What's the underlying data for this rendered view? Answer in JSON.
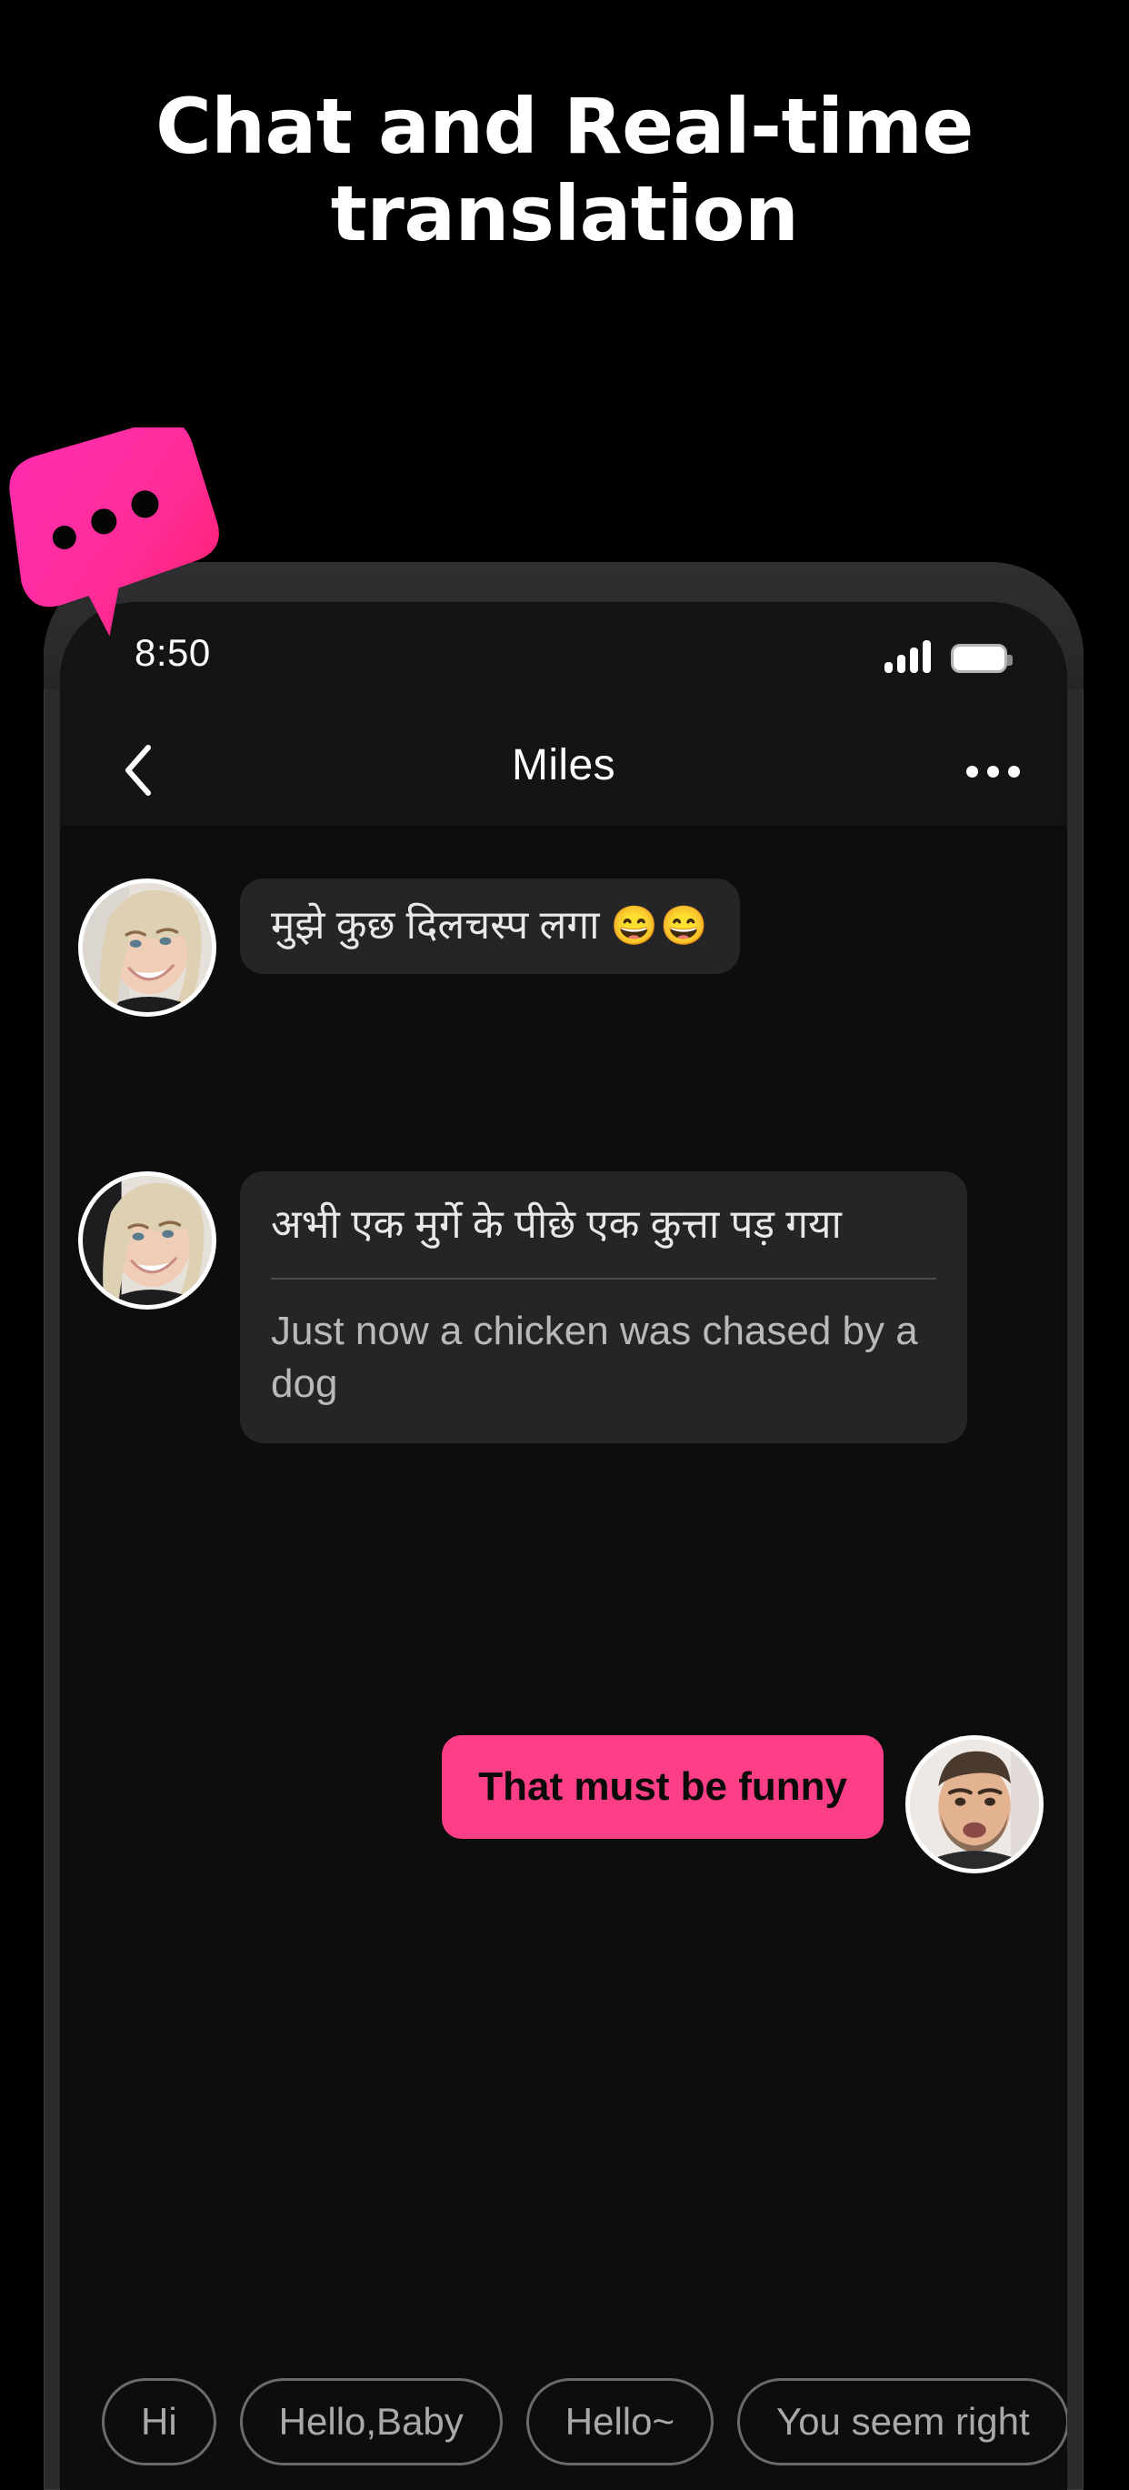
{
  "promo": {
    "headline": "Chat and Real-time\ntranslation",
    "badge_icon": "chat-bubble-icon",
    "accent_color": "#fb3e86",
    "background_color": "#000000"
  },
  "phone": {
    "status_bar": {
      "time": "8:50",
      "signal_icon": "signal-bars-icon",
      "signal_bars": 4,
      "battery_icon": "battery-full-icon"
    },
    "chat_header": {
      "back_icon": "chevron-left-icon",
      "title": "Miles",
      "more_icon": "more-horizontal-icon"
    },
    "messages": [
      {
        "id": "msg-1",
        "direction": "incoming",
        "avatar": "avatar-miles",
        "text": "मुझे कुछ दिलचस्प लगा",
        "emoji": "😄😄",
        "translation": null
      },
      {
        "id": "msg-2",
        "direction": "incoming",
        "avatar": "avatar-miles",
        "text": "अभी एक मुर्गे के पीछे एक कुत्ता पड़ गया",
        "emoji": "",
        "translation": "Just now a chicken was chased by a dog"
      },
      {
        "id": "msg-3",
        "direction": "outgoing",
        "avatar": "avatar-self",
        "text": "That must be funny",
        "emoji": "",
        "translation": null
      }
    ],
    "quick_replies": [
      {
        "label": "Hi"
      },
      {
        "label": "Hello,Baby"
      },
      {
        "label": "Hello~"
      },
      {
        "label": "You seem right"
      }
    ]
  }
}
